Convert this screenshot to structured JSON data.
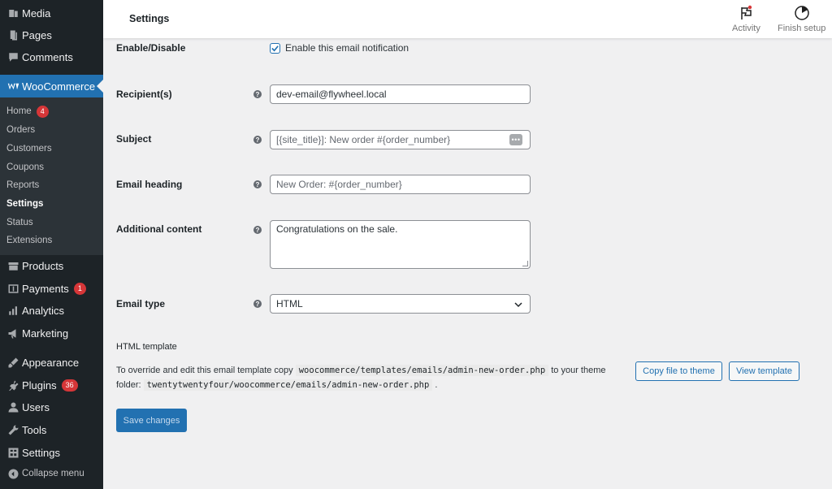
{
  "sidebar": {
    "top_items": [
      {
        "label": "Media",
        "icon": "media-icon"
      },
      {
        "label": "Pages",
        "icon": "pages-icon"
      },
      {
        "label": "Comments",
        "icon": "comments-icon"
      }
    ],
    "woocommerce": {
      "label": "WooCommerce",
      "icon": "woocommerce-icon"
    },
    "submenu": [
      {
        "label": "Home",
        "badge": "4"
      },
      {
        "label": "Orders"
      },
      {
        "label": "Customers"
      },
      {
        "label": "Coupons"
      },
      {
        "label": "Reports"
      },
      {
        "label": "Settings",
        "active": true
      },
      {
        "label": "Status"
      },
      {
        "label": "Extensions"
      }
    ],
    "bottom_items": [
      {
        "label": "Products",
        "icon": "products-icon"
      },
      {
        "label": "Payments",
        "icon": "payments-icon",
        "badge": "1"
      },
      {
        "label": "Analytics",
        "icon": "analytics-icon"
      },
      {
        "label": "Marketing",
        "icon": "marketing-icon"
      },
      {
        "label": "Appearance",
        "icon": "appearance-icon"
      },
      {
        "label": "Plugins",
        "icon": "plugins-icon",
        "badge": "36"
      },
      {
        "label": "Users",
        "icon": "users-icon"
      },
      {
        "label": "Tools",
        "icon": "tools-icon"
      },
      {
        "label": "Settings",
        "icon": "settings-icon"
      },
      {
        "label": "Collapse menu",
        "icon": "collapse-icon"
      }
    ]
  },
  "header": {
    "title": "Settings",
    "activity_label": "Activity",
    "finish_setup_label": "Finish setup"
  },
  "form": {
    "enable": {
      "label": "Enable/Disable",
      "checkbox_label": "Enable this email notification",
      "checked": true
    },
    "recipient": {
      "label": "Recipient(s)",
      "value": "dev-email@flywheel.local"
    },
    "subject": {
      "label": "Subject",
      "placeholder": "[{site_title}]: New order #{order_number}"
    },
    "heading": {
      "label": "Email heading",
      "placeholder": "New Order: #{order_number}"
    },
    "additional": {
      "label": "Additional content",
      "value": "Congratulations on the sale."
    },
    "email_type": {
      "label": "Email type",
      "value": "HTML"
    }
  },
  "template": {
    "title": "HTML template",
    "text_1": "To override and edit this email template copy",
    "code_1": "woocommerce/templates/emails/admin-new-order.php",
    "text_2": "to your theme",
    "text_3": "folder:",
    "code_2": "twentytwentyfour/woocommerce/emails/admin-new-order.php",
    "text_4": ".",
    "copy_button": "Copy file to theme",
    "view_button": "View template"
  },
  "save_button": "Save changes",
  "colors": {
    "accent": "#2271b1",
    "sidebar_bg": "#1d2327",
    "badge": "#d63638"
  }
}
